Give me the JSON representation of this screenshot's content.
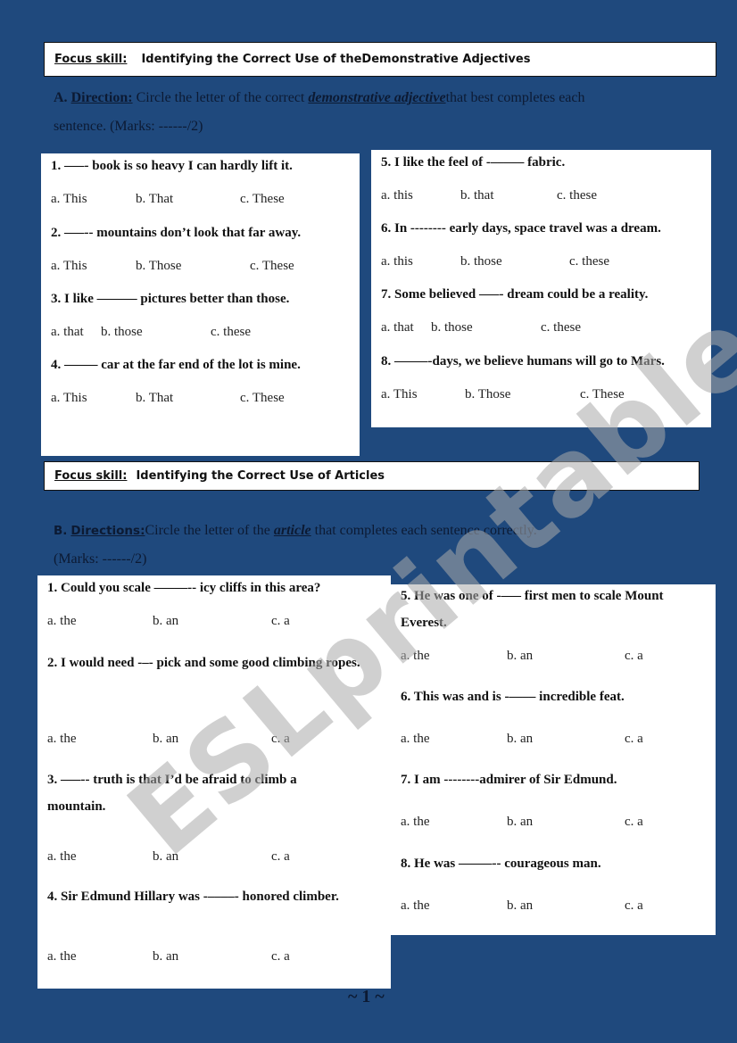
{
  "section_a": {
    "focus_label": "Focus skill:",
    "focus_title": "Identifying the Correct Use of theDemonstrative Adjectives",
    "direction_letter": "A.",
    "direction_label": "Direction:",
    "direction_text_1": " Circle the letter of the correct ",
    "direction_emphasis": "demonstrative adjective",
    "direction_text_2": "that best completes each",
    "direction_line2": "sentence. (Marks: ------/2)",
    "questions": [
      {
        "text": "1. –––- book is so heavy I can hardly lift it.",
        "options": [
          "a. This",
          "b. That",
          "c. These"
        ]
      },
      {
        "text": "2.  –––-- mountains don’t look that far away.",
        "options": [
          "a. This",
          "b. Those",
          "c. These"
        ]
      },
      {
        "text": "3. I like ––––––  pictures better than those.",
        "options": [
          "a. that",
          "b. those",
          "c. these"
        ]
      },
      {
        "text": "4. ––––– car at the far end of the lot is mine.",
        "options": [
          "a. This",
          "b. That",
          "c. These"
        ]
      },
      {
        "text": "5.  I like the feel of -––––– fabric.",
        "options": [
          "a. this",
          "b. that",
          "c. these"
        ]
      },
      {
        "text": "6.  In -------- early days, space travel was a dream.",
        "options": [
          "a. this",
          "b. those",
          "c. these"
        ]
      },
      {
        "text": "7.  Some believed –––- dream could be a reality.",
        "options": [
          "a. that",
          "b. those",
          "c. these"
        ]
      },
      {
        "text": "8.  –––––-days, we believe humans will go to Mars.",
        "options": [
          "a. This",
          "b. Those",
          "c. These"
        ]
      }
    ]
  },
  "section_b": {
    "focus_label": "Focus skill:",
    "focus_title": "Identifying  the Correct Use of Articles",
    "direction_letter": "B.",
    "direction_label": "Directions:",
    "direction_text_1": "Circle the letter of the ",
    "direction_emphasis": "article",
    "direction_text_2": " that completes each sentence correctly.",
    "direction_line2": "(Marks: ------/2)",
    "questions": [
      {
        "text": "1.  Could you  scale –––––-- icy cliffs in this area?",
        "options": [
          "a.  the",
          "b. an",
          "c.  a"
        ]
      },
      {
        "text": "2.  I would need -–- pick and some good climbing ropes.",
        "options": [
          "a.  the",
          "b. an",
          "c.  a"
        ]
      },
      {
        "text": "3. –––-- truth is that  I’d be afraid to climb a mountain.",
        "options": [
          "a.  the",
          "b. an",
          "c.  a"
        ]
      },
      {
        "text": "4.  Sir  Edmund Hillary  was -––––- honored climber.",
        "options": [
          "a.  the",
          "b. an",
          "c.  a"
        ]
      },
      {
        "text": "5.  He was one of -––– first men to scale Mount Everest.",
        "options": [
          "a.  the",
          "b. an",
          "c.  a"
        ]
      },
      {
        "text": "6.  This was and is -–––– incredible feat.",
        "options": [
          "a.  the",
          "b. an",
          "c.  a"
        ]
      },
      {
        "text": "7. I am --------admirer of Sir Edmund.",
        "options": [
          "a.  the",
          "b. an",
          "c.  a"
        ]
      },
      {
        "text": "8.  He was –––––-- courageous man.",
        "options": [
          "a.  the",
          "b. an",
          "c.  a"
        ]
      }
    ]
  },
  "watermark": "ESLprintables.com",
  "page_number": "~ 1 ~"
}
